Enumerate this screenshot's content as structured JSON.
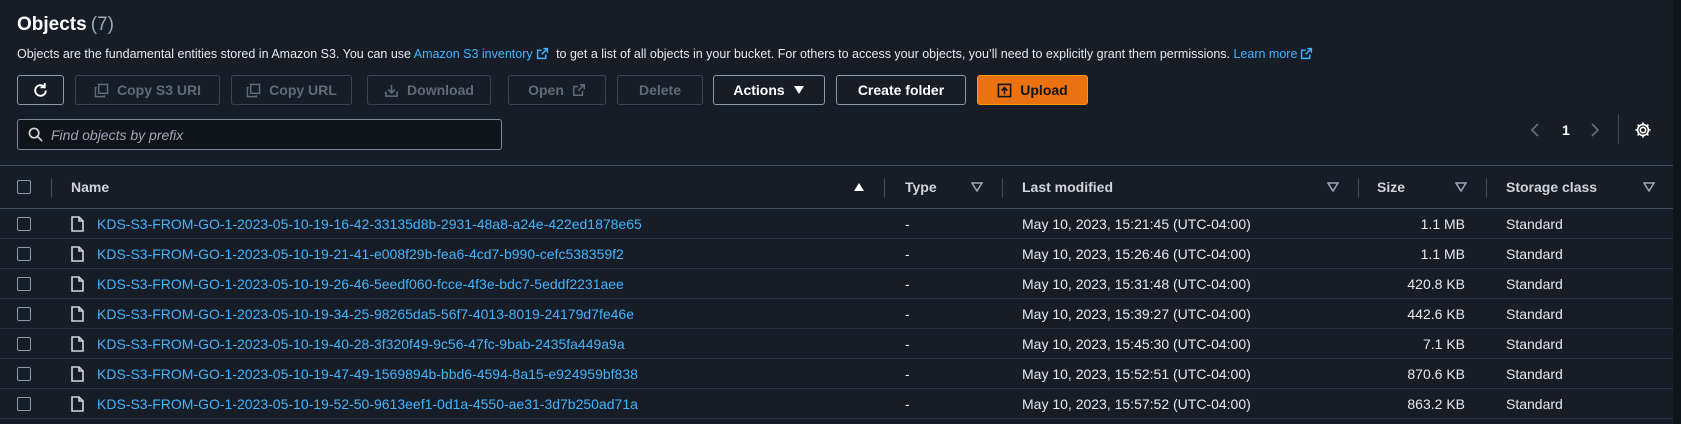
{
  "header": {
    "title": "Objects",
    "count": "(7)",
    "description_before": "Objects are the fundamental entities stored in Amazon S3. You can use ",
    "inventory_link": "Amazon S3 inventory",
    "description_after": " to get a list of all objects in your bucket. For others to access your objects, you’ll need to explicitly grant them permissions. ",
    "learn_more": "Learn more"
  },
  "toolbar": {
    "copy_uri": "Copy S3 URI",
    "copy_url": "Copy URL",
    "download": "Download",
    "open": "Open",
    "delete": "Delete",
    "actions": "Actions",
    "create_folder": "Create folder",
    "upload": "Upload"
  },
  "search": {
    "placeholder": "Find objects by prefix",
    "value": ""
  },
  "pagination": {
    "current_page": "1"
  },
  "table": {
    "columns": {
      "name": "Name",
      "type": "Type",
      "last_modified": "Last modified",
      "size": "Size",
      "storage_class": "Storage class"
    },
    "rows": [
      {
        "name": "KDS-S3-FROM-GO-1-2023-05-10-19-16-42-33135d8b-2931-48a8-a24e-422ed1878e65",
        "type": "-",
        "last_modified": "May 10, 2023, 15:21:45 (UTC-04:00)",
        "size": "1.1 MB",
        "storage_class": "Standard"
      },
      {
        "name": "KDS-S3-FROM-GO-1-2023-05-10-19-21-41-e008f29b-fea6-4cd7-b990-cefc538359f2",
        "type": "-",
        "last_modified": "May 10, 2023, 15:26:46 (UTC-04:00)",
        "size": "1.1 MB",
        "storage_class": "Standard"
      },
      {
        "name": "KDS-S3-FROM-GO-1-2023-05-10-19-26-46-5eedf060-fcce-4f3e-bdc7-5eddf2231aee",
        "type": "-",
        "last_modified": "May 10, 2023, 15:31:48 (UTC-04:00)",
        "size": "420.8 KB",
        "storage_class": "Standard"
      },
      {
        "name": "KDS-S3-FROM-GO-1-2023-05-10-19-34-25-98265da5-56f7-4013-8019-24179d7fe46e",
        "type": "-",
        "last_modified": "May 10, 2023, 15:39:27 (UTC-04:00)",
        "size": "442.6 KB",
        "storage_class": "Standard"
      },
      {
        "name": "KDS-S3-FROM-GO-1-2023-05-10-19-40-28-3f320f49-9c56-47fc-9bab-2435fa449a9a",
        "type": "-",
        "last_modified": "May 10, 2023, 15:45:30 (UTC-04:00)",
        "size": "7.1 KB",
        "storage_class": "Standard"
      },
      {
        "name": "KDS-S3-FROM-GO-1-2023-05-10-19-47-49-1569894b-bbd6-4594-8a15-e924959bf838",
        "type": "-",
        "last_modified": "May 10, 2023, 15:52:51 (UTC-04:00)",
        "size": "870.6 KB",
        "storage_class": "Standard"
      },
      {
        "name": "KDS-S3-FROM-GO-1-2023-05-10-19-52-50-9613eef1-0d1a-4550-ae31-3d7b250ad71a",
        "type": "-",
        "last_modified": "May 10, 2023, 15:57:52 (UTC-04:00)",
        "size": "863.2 KB",
        "storage_class": "Standard"
      }
    ]
  },
  "colors": {
    "background": "#161d26",
    "link": "#42b4ff",
    "primary_button": "#ec7211",
    "border": "#414d5c"
  },
  "icons": {
    "refresh": "refresh-icon",
    "copy": "copy-icon",
    "download": "download-icon",
    "external": "external-link-icon",
    "caret": "caret-down-icon",
    "upload": "upload-icon",
    "search": "search-icon",
    "settings": "gear-icon",
    "file": "file-icon"
  }
}
